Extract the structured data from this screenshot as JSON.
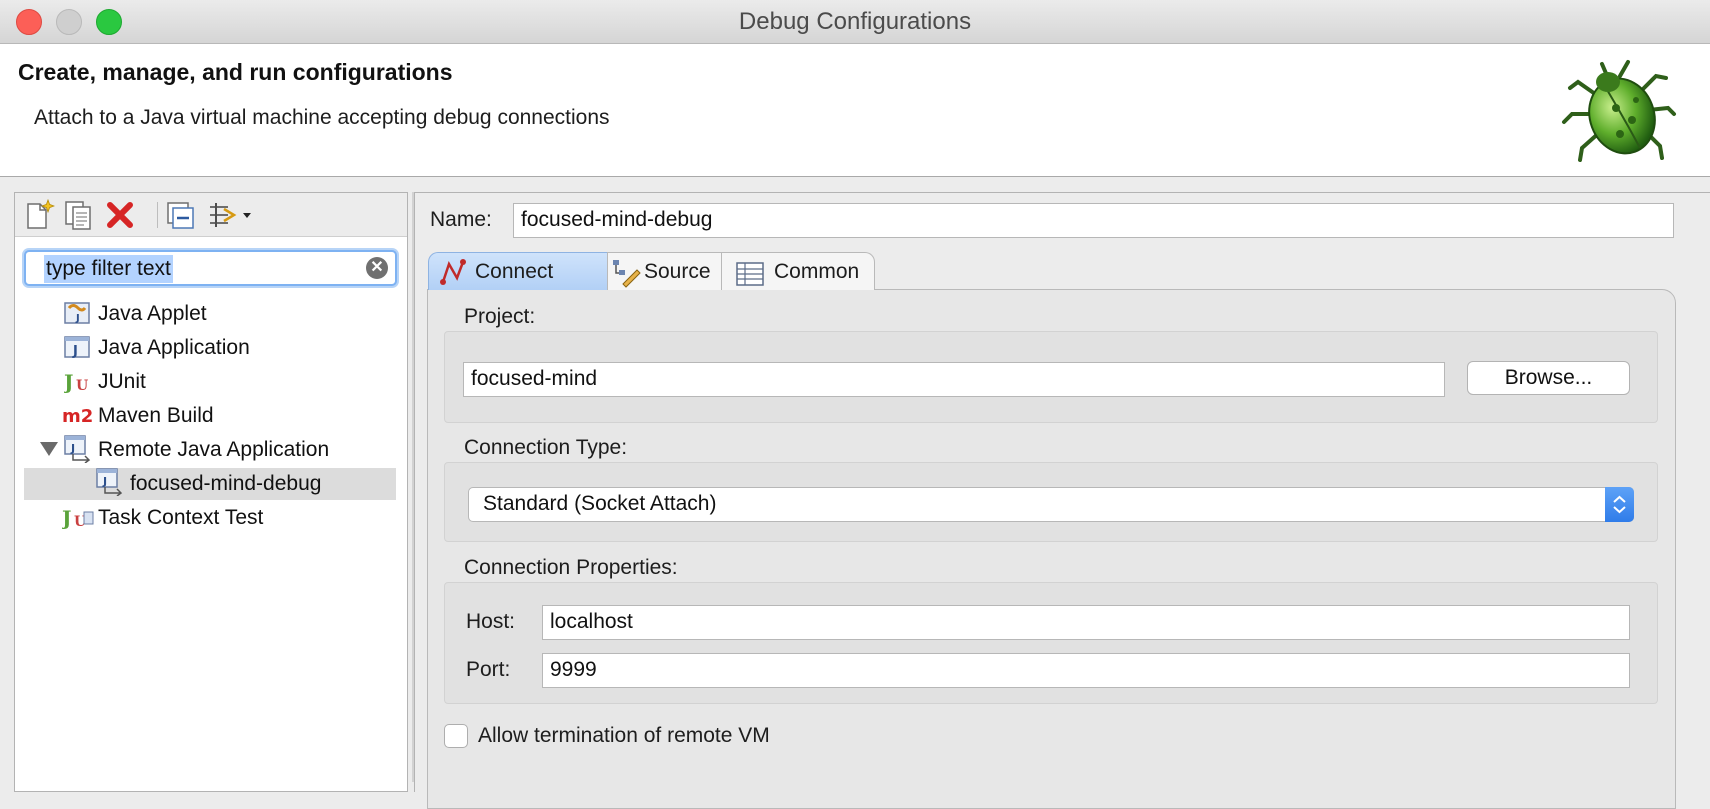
{
  "window": {
    "title": "Debug Configurations"
  },
  "header": {
    "title": "Create, manage, and run configurations",
    "description": "Attach to a Java virtual machine accepting debug connections"
  },
  "toolbar": {
    "buttons": [
      "new-configuration-icon",
      "duplicate-icon",
      "delete-icon",
      "collapse-all-icon",
      "filter-icon"
    ]
  },
  "filter": {
    "text": "type filter text"
  },
  "tree": {
    "items": [
      {
        "label": "Java Applet",
        "icon": "java-applet-icon"
      },
      {
        "label": "Java Application",
        "icon": "java-application-icon"
      },
      {
        "label": "JUnit",
        "icon": "junit-icon"
      },
      {
        "label": "Maven Build",
        "icon": "maven-icon"
      },
      {
        "label": "Remote Java Application",
        "icon": "remote-java-icon",
        "expanded": true
      },
      {
        "label": "focused-mind-debug",
        "icon": "remote-java-icon",
        "selected": true
      },
      {
        "label": "Task Context Test",
        "icon": "junit-icon"
      }
    ]
  },
  "config": {
    "name_label": "Name:",
    "name_value": "focused-mind-debug",
    "tabs": [
      {
        "label": "Connect",
        "active": true
      },
      {
        "label": "Source",
        "active": false
      },
      {
        "label": "Common",
        "active": false
      }
    ],
    "project_label": "Project:",
    "project_value": "focused-mind",
    "browse_label": "Browse...",
    "connection_type_label": "Connection Type:",
    "connection_type_value": "Standard (Socket Attach)",
    "connection_properties_label": "Connection Properties:",
    "host_label": "Host:",
    "host_value": "localhost",
    "port_label": "Port:",
    "port_value": "9999",
    "allow_termination_label": "Allow termination of remote VM",
    "allow_termination_checked": false
  },
  "colors": {
    "accent": "#3b82f0",
    "selection": "#dcdcdc",
    "close": "#fc5f57",
    "maximize": "#2ac840"
  }
}
